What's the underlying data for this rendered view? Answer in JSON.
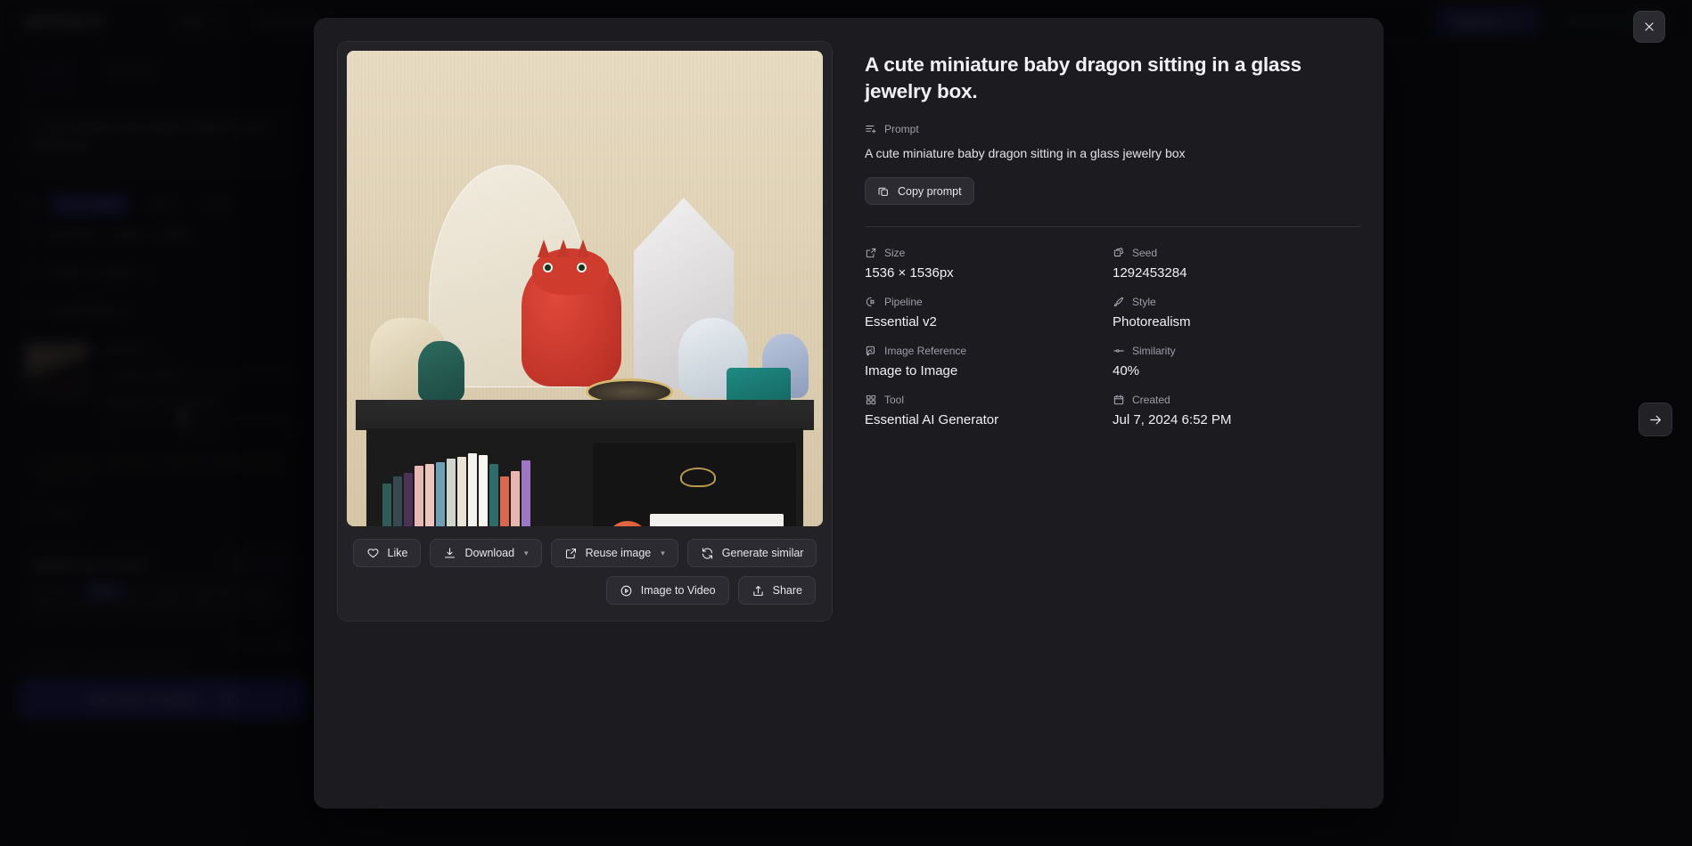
{
  "background": {
    "logo": "getimg.ai",
    "nav": [
      {
        "label": "Tools"
      },
      {
        "label": "Resources"
      }
    ],
    "upgrade_label": "Upgrade",
    "plan_label": "Free plan",
    "plan_credits": "7 / 100",
    "tabs": [
      {
        "label": "Essential",
        "active": true
      },
      {
        "label": "Advanced",
        "active": false
      }
    ],
    "prompt_value": "A cute miniature baby dragon sitting in a glass jewelry box",
    "style_label": "Style",
    "style_pills": [
      {
        "label": "Photorealism",
        "active": true
      },
      {
        "label": "Artistic",
        "active": false
      },
      {
        "label": "Anime",
        "active": false
      }
    ],
    "rows": [
      {
        "label": "Resolution",
        "value": "1536px × 1536px"
      },
      {
        "label": "Number of images",
        "value": "2"
      },
      {
        "label": "Image Reference",
        "value": ""
      }
    ],
    "reference": {
      "title": "Reference",
      "mode": "Image to Image",
      "similarity_label": "Similarity to the image",
      "similarity_value": "40%",
      "ticks": [
        "Little",
        "Moderate",
        "Copy"
      ]
    },
    "warning": "Image aspect ratio does not match the output resolution aspect ratio.",
    "seed_row": "Seed",
    "upgrade_card": {
      "title": "Upgrade your account",
      "button": "Upgrade",
      "text_before": "Purchase a",
      "highlight": "Basic",
      "text_after": "plan or higher to generate images faster, get higher image quality and access more features."
    },
    "meta_right": "Become a sidekick",
    "credits_note": "You need 2 credits for this generation.",
    "generate_label": "Generate 2 images",
    "generate_cost": "2"
  },
  "modal": {
    "title": "A cute miniature baby dragon sitting in a glass jewelry box.",
    "prompt_label": "Prompt",
    "prompt_text": "A cute miniature baby dragon sitting in a glass jewelry box",
    "copy_prompt_label": "Copy prompt",
    "close_label": "Close",
    "next_label": "Next image",
    "actions_primary": [
      {
        "name": "like",
        "label": "Like",
        "has_caret": false
      },
      {
        "name": "download",
        "label": "Download",
        "has_caret": true
      },
      {
        "name": "reuse-image",
        "label": "Reuse image",
        "has_caret": true
      },
      {
        "name": "generate-similar",
        "label": "Generate similar",
        "has_caret": false
      }
    ],
    "actions_secondary": [
      {
        "name": "image-to-video",
        "label": "Image to Video",
        "has_caret": false
      },
      {
        "name": "share",
        "label": "Share",
        "has_caret": false
      }
    ],
    "metadata": [
      {
        "icon": "size-icon",
        "label": "Size",
        "value": "1536 × 1536px"
      },
      {
        "icon": "dice-icon",
        "label": "Seed",
        "value": "1292453284"
      },
      {
        "icon": "pipeline-icon",
        "label": "Pipeline",
        "value": "Essential v2"
      },
      {
        "icon": "brush-icon",
        "label": "Style",
        "value": "Photorealism"
      },
      {
        "icon": "image-reference-icon",
        "label": "Image Reference",
        "value": "Image to Image"
      },
      {
        "icon": "slider-icon",
        "label": "Similarity",
        "value": "40%"
      },
      {
        "icon": "grid-icon",
        "label": "Tool",
        "value": "Essential AI Generator"
      },
      {
        "icon": "calendar-icon",
        "label": "Created",
        "value": "Jul 7, 2024 6:52 PM"
      }
    ]
  },
  "colors": {
    "accent": "#3b35c9",
    "modal_bg": "#1c1c20",
    "button_bg": "#2b2b31",
    "text_primary": "#f2f2f6",
    "text_muted": "#9d9da7",
    "plan_bar": "#1f7a4d",
    "warning": "#b08a2e"
  }
}
